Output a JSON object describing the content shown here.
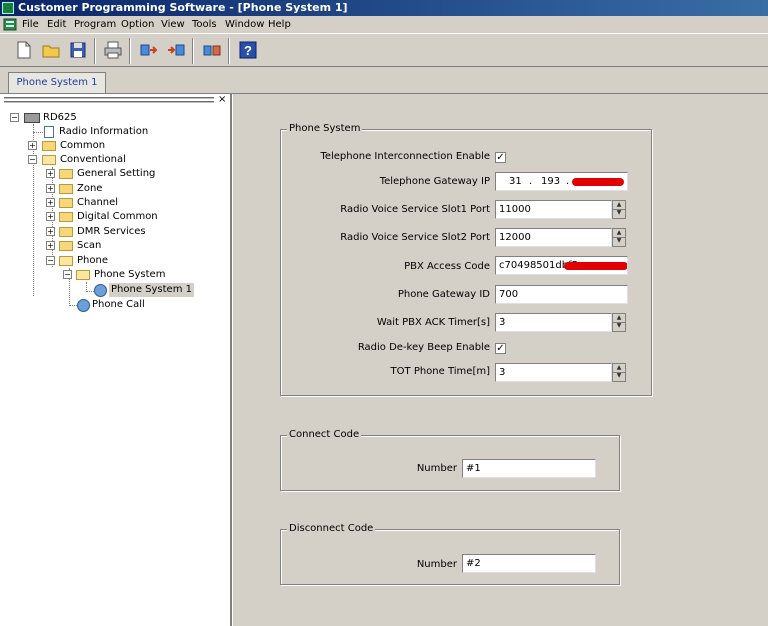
{
  "window": {
    "title": "Customer Programming Software - [Phone System 1]"
  },
  "menu": [
    "File",
    "Edit",
    "Program",
    "Option",
    "View",
    "Tools",
    "Window",
    "Help"
  ],
  "toolbar": {
    "icons": [
      "new-file-icon",
      "open-folder-icon",
      "save-icon",
      "print-icon",
      "read-radio-icon",
      "write-radio-icon",
      "clone-icon",
      "help-icon"
    ],
    "help_glyph": "?"
  },
  "tabs": [
    {
      "label": "Phone System 1"
    }
  ],
  "tree": {
    "close_glyph": "×",
    "items": [
      {
        "label": "RD625",
        "level": 0
      },
      {
        "label": "Radio Information",
        "level": 1
      },
      {
        "label": "Common",
        "level": 1
      },
      {
        "label": "Conventional",
        "level": 1
      },
      {
        "label": "General Setting",
        "level": 2
      },
      {
        "label": "Zone",
        "level": 2
      },
      {
        "label": "Channel",
        "level": 2
      },
      {
        "label": "Digital Common",
        "level": 2
      },
      {
        "label": "DMR Services",
        "level": 2
      },
      {
        "label": "Scan",
        "level": 2
      },
      {
        "label": "Phone",
        "level": 2
      },
      {
        "label": "Phone System",
        "level": 3
      },
      {
        "label": "Phone System 1",
        "level": 4,
        "selected": true
      },
      {
        "label": "Phone Call",
        "level": 3
      }
    ]
  },
  "phone_system": {
    "title": "Phone System",
    "tel_interconnect_label": "Telephone Interconnection Enable",
    "tel_interconnect_checked": true,
    "gateway_ip_label": "Telephone Gateway IP",
    "gateway_ip_octets": [
      "31",
      "193",
      "",
      ""
    ],
    "slot1_label": "Radio Voice Service Slot1 Port",
    "slot1_value": "11000",
    "slot2_label": "Radio Voice Service Slot2 Port",
    "slot2_value": "12000",
    "pbx_code_label": "PBX Access Code",
    "pbx_code_value": "c70498501dbf5",
    "gateway_id_label": "Phone Gateway ID",
    "gateway_id_value": "700",
    "wait_ack_label": "Wait PBX ACK Timer[s]",
    "wait_ack_value": "3",
    "dekey_beep_label": "Radio De-key Beep Enable",
    "dekey_beep_checked": true,
    "tot_label": "TOT Phone Time[m]",
    "tot_value": "3",
    "check_glyph": "✓",
    "ip_dot": "."
  },
  "connect_code": {
    "title": "Connect Code",
    "number_label": "Number",
    "number_value": "#1"
  },
  "disconnect_code": {
    "title": "Disconnect Code",
    "number_label": "Number",
    "number_value": "#2"
  },
  "colors": {
    "title_start": "#0a246a",
    "title_end": "#3a6ea5",
    "tab_text": "#1a3fa0",
    "redaction": "#e10000"
  }
}
